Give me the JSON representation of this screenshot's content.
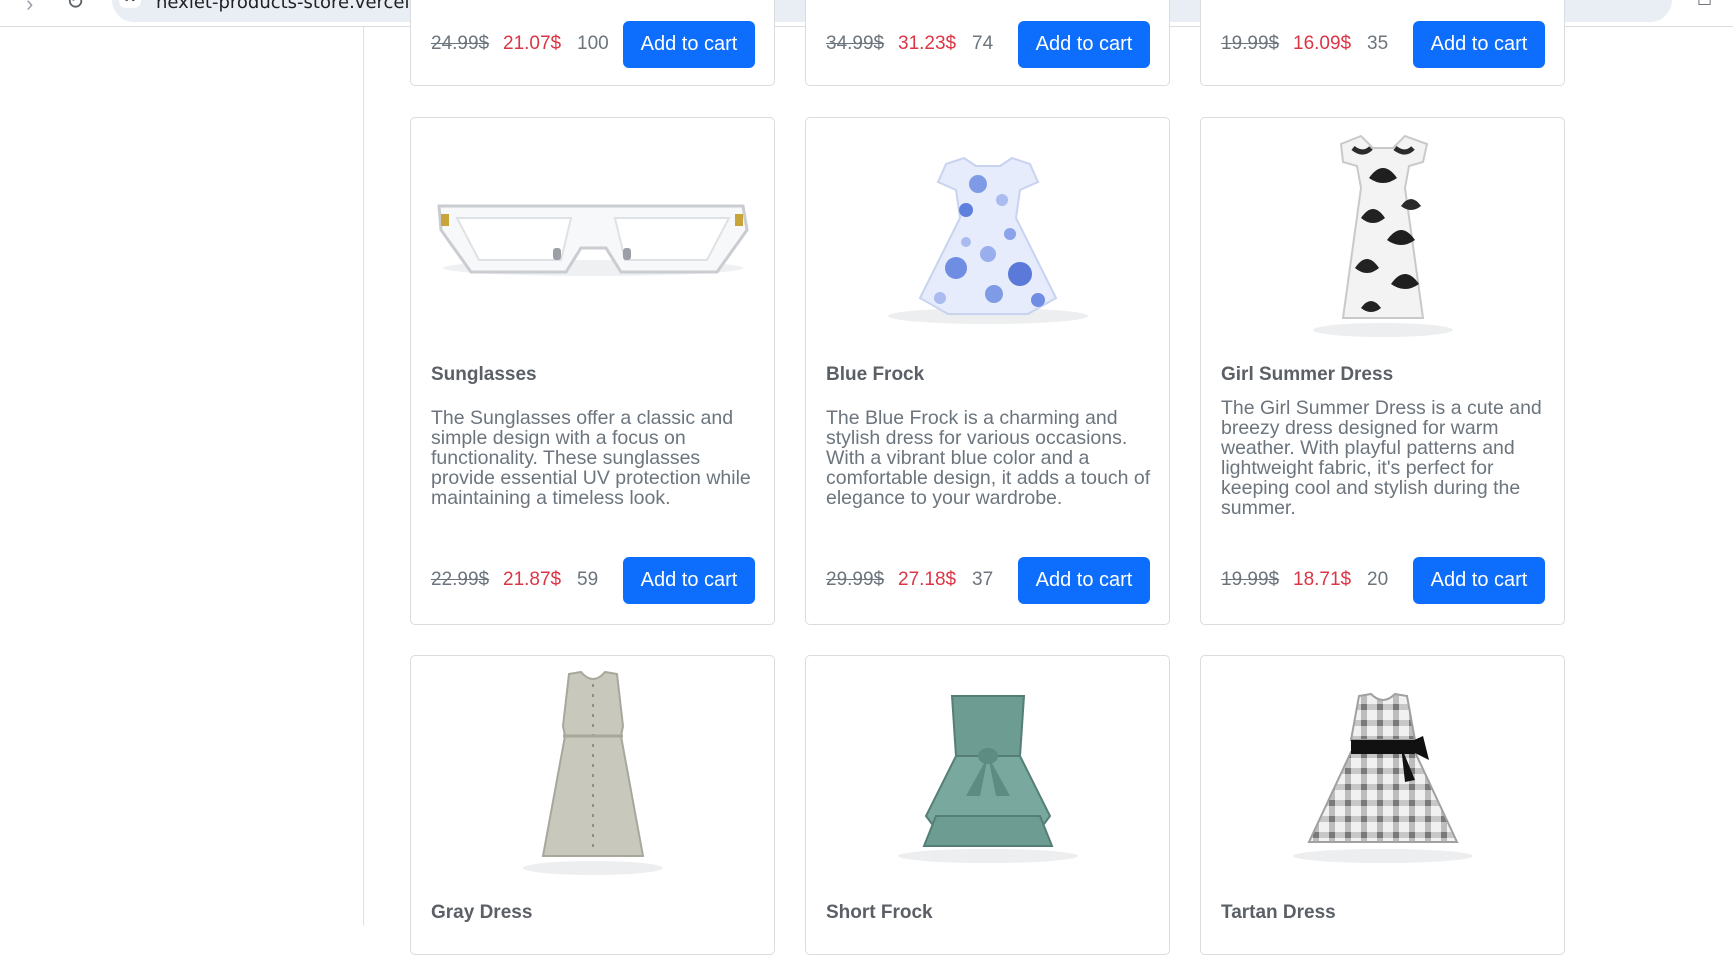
{
  "browser": {
    "url": "hexlet-products-store.vercel.app",
    "forward_glyph": "›",
    "reload_glyph": "↻",
    "site_info_glyph": "⊶",
    "device_glyph": "▭"
  },
  "button_label": "Add to cart",
  "colors": {
    "primary": "#0d6efd",
    "sale_price": "#dc3545",
    "muted_text": "#6c757d",
    "card_border": "#d9dde1"
  },
  "top_row": [
    {
      "old_price": "24.99$",
      "new_price": "21.07$",
      "stock": "100"
    },
    {
      "old_price": "34.99$",
      "new_price": "31.23$",
      "stock": "74"
    },
    {
      "old_price": "19.99$",
      "new_price": "16.09$",
      "stock": "35"
    }
  ],
  "products": [
    {
      "title": "Sunglasses",
      "image": "sunglasses-image",
      "description": "The Sunglasses offer a classic and simple design with a focus on functionality. These sunglasses provide essential UV protection while maintaining a timeless look.",
      "old_price": "22.99$",
      "new_price": "21.87$",
      "stock": "59"
    },
    {
      "title": "Blue Frock",
      "image": "blue-frock-image",
      "description": "The Blue Frock is a charming and stylish dress for various occasions. With a vibrant blue color and a comfortable design, it adds a touch of elegance to your wardrobe.",
      "old_price": "29.99$",
      "new_price": "27.18$",
      "stock": "37"
    },
    {
      "title": "Girl Summer Dress",
      "image": "girl-summer-dress-image",
      "description": "The Girl Summer Dress is a cute and breezy dress designed for warm weather. With playful patterns and lightweight fabric, it's perfect for keeping cool and stylish during the summer.",
      "old_price": "19.99$",
      "new_price": "18.71$",
      "stock": "20"
    }
  ],
  "bottom_row": [
    {
      "title": "Gray Dress",
      "image": "gray-dress-image"
    },
    {
      "title": "Short Frock",
      "image": "short-frock-image"
    },
    {
      "title": "Tartan Dress",
      "image": "tartan-dress-image"
    }
  ]
}
